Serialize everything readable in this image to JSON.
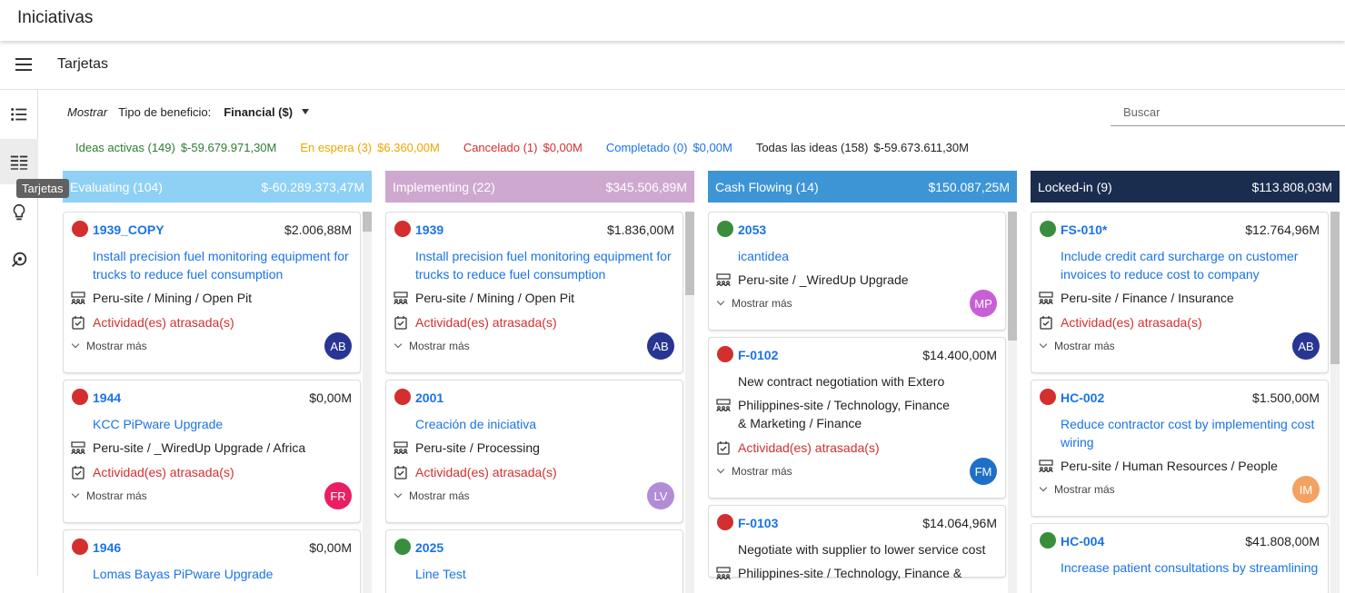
{
  "app": {
    "title": "Iniciativas"
  },
  "toolbar": {
    "title": "Tarjetas"
  },
  "sidebar": {
    "tooltip": "Tarjetas"
  },
  "filter": {
    "mostrar": "Mostrar",
    "label": "Tipo de beneficio:",
    "value": "Financial ($)",
    "search_placeholder": "Buscar"
  },
  "stats": [
    {
      "label": "Ideas activas (149)",
      "value": "$-59.679.971,30M",
      "color": "#2e7d32"
    },
    {
      "label": "En espera (3)",
      "value": "$6.360,00M",
      "color": "#f0a500"
    },
    {
      "label": "Cancelado (1)",
      "value": "$0,00M",
      "color": "#d32f2f"
    },
    {
      "label": "Completado (0)",
      "value": "$0,00M",
      "color": "#1a73e8"
    },
    {
      "label": "Todas las ideas (158)",
      "value": "$-59.673.611,30M",
      "color": "#222222"
    }
  ],
  "columns": [
    {
      "name": "Evaluating (104)",
      "total": "$-60.289.373,47M",
      "color": "#8fd0f5",
      "cards": [
        {
          "id": "1939_COPY",
          "amount": "$2.006,88M",
          "status": "#d32f2f",
          "title": "Install precision fuel monitoring equipment for trucks to reduce fuel consumption",
          "title_color": "blue",
          "location": "Peru-site / Mining / Open Pit",
          "late": "Actividad(es) atrasada(s)",
          "more": "Mostrar más",
          "avatar": "AB",
          "avatar_color": "#283593"
        },
        {
          "id": "1944",
          "amount": "$0,00M",
          "status": "#d32f2f",
          "title": "KCC PiPware Upgrade",
          "title_color": "blue",
          "location": "Peru-site / _WiredUp Upgrade / Africa",
          "late": "Actividad(es) atrasada(s)",
          "more": "Mostrar más",
          "avatar": "FR",
          "avatar_color": "#e91e63"
        },
        {
          "id": "1946",
          "amount": "$0,00M",
          "status": "#d32f2f",
          "title": "Lomas Bayas PiPware Upgrade",
          "title_color": "blue"
        }
      ]
    },
    {
      "name": "Implementing (22)",
      "total": "$345.506,89M",
      "color": "#cfa8d0",
      "cards": [
        {
          "id": "1939",
          "amount": "$1.836,00M",
          "status": "#d32f2f",
          "title": "Install precision fuel monitoring equipment for trucks to reduce fuel consumption",
          "title_color": "blue",
          "location": "Peru-site / Mining / Open Pit",
          "late": "Actividad(es) atrasada(s)",
          "more": "Mostrar más",
          "avatar": "AB",
          "avatar_color": "#283593"
        },
        {
          "id": "2001",
          "amount": "",
          "status": "#d32f2f",
          "title": "Creación de iniciativa",
          "title_color": "blue",
          "location": "Peru-site / Processing",
          "late": "Actividad(es) atrasada(s)",
          "more": "Mostrar más",
          "avatar": "LV",
          "avatar_color": "#b28dd6"
        },
        {
          "id": "2025",
          "amount": "",
          "status": "#388e3c",
          "title": "Line Test",
          "title_color": "blue"
        }
      ]
    },
    {
      "name": "Cash Flowing (14)",
      "total": "$150.087,25M",
      "color": "#3d95d6",
      "cards": [
        {
          "id": "2053",
          "amount": "",
          "status": "#388e3c",
          "title": "icantidea",
          "title_color": "blue",
          "location": "Peru-site / _WiredUp Upgrade",
          "more": "Mostrar más",
          "avatar": "MP",
          "avatar_color": "#c85fd6"
        },
        {
          "id": "F-0102",
          "amount": "$14.400,00M",
          "status": "#d32f2f",
          "title": "New contract negotiation with Extero",
          "title_color": "black",
          "location": "Philippines-site / Technology, Finance & Marketing / Finance",
          "late": "Actividad(es) atrasada(s)",
          "more": "Mostrar más",
          "avatar": "FM",
          "avatar_color": "#1e6fc8"
        },
        {
          "id": "F-0103",
          "amount": "$14.064,96M",
          "status": "#d32f2f",
          "title": "Negotiate with supplier to lower service cost",
          "title_color": "black",
          "location": "Philippines-site / Technology, Finance &"
        }
      ]
    },
    {
      "name": "Locked-in (9)",
      "total": "$113.808,03M",
      "color": "#1b2d4f",
      "cards": [
        {
          "id": "FS-010*",
          "amount": "$12.764,96M",
          "status": "#388e3c",
          "title": "Include credit card surcharge on customer invoices to reduce cost to company",
          "title_color": "blue",
          "location": "Peru-site / Finance / Insurance",
          "late": "Actividad(es) atrasada(s)",
          "more": "Mostrar más",
          "avatar": "AB",
          "avatar_color": "#283593"
        },
        {
          "id": "HC-002",
          "amount": "$1.500,00M",
          "status": "#d32f2f",
          "title": "Reduce contractor cost by implementing cost wiring",
          "title_color": "blue",
          "location": "Peru-site / Human Resources / People",
          "more": "Mostrar más",
          "avatar": "IM",
          "avatar_color": "#f4a261"
        },
        {
          "id": "HC-004",
          "amount": "$41.808,00M",
          "status": "#388e3c",
          "title": "Increase patient consultations by streamlining",
          "title_color": "blue"
        }
      ]
    }
  ]
}
